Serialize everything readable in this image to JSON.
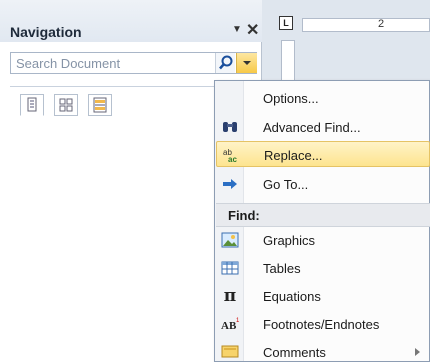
{
  "nav": {
    "title": "Navigation",
    "menu_arrow": "▼",
    "close": "✕",
    "search_placeholder": "Search Document"
  },
  "ruler": {
    "corner": "L",
    "number": "2"
  },
  "menu": {
    "items_top": [
      {
        "label": "Options...",
        "icon": "none"
      },
      {
        "label": "Advanced Find...",
        "icon": "binoculars-icon"
      },
      {
        "label": "Replace...",
        "icon": "replace-icon",
        "highlighted": true
      },
      {
        "label": "Go To...",
        "icon": "arrow-right-icon"
      }
    ],
    "find_header": "Find:",
    "items_find": [
      {
        "label": "Graphics",
        "icon": "picture-icon"
      },
      {
        "label": "Tables",
        "icon": "table-icon"
      },
      {
        "label": "Equations",
        "icon": "pi-icon"
      },
      {
        "label": "Footnotes/Endnotes",
        "icon": "footnote-icon"
      },
      {
        "label": "Comments",
        "icon": "comment-icon",
        "has_submenu": true
      }
    ]
  },
  "colors": {
    "highlight": "#fde48f",
    "search_drop": "#f7c948",
    "header_bg": "#e1e8f1"
  }
}
